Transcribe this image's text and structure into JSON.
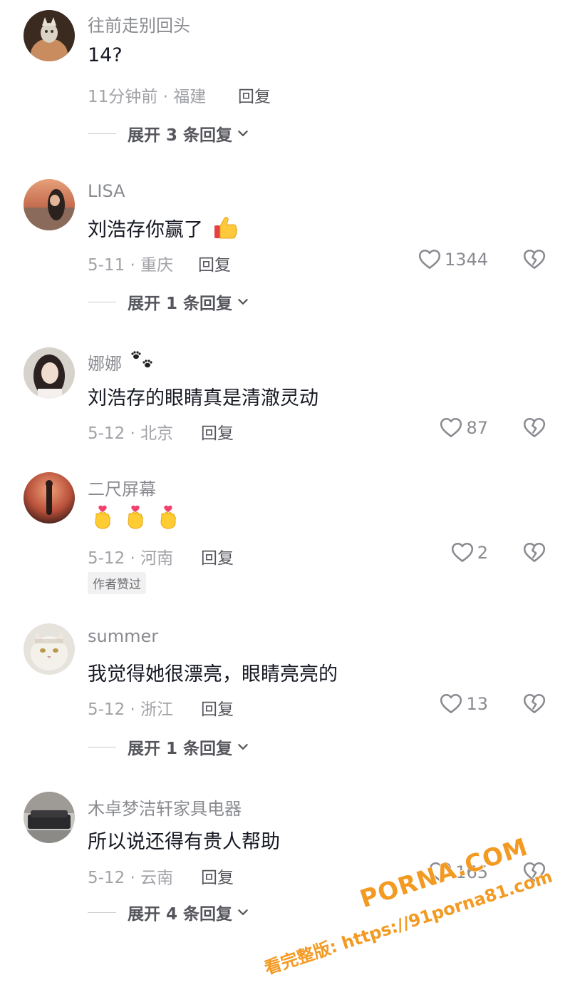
{
  "comments": [
    {
      "username": "往前走别回头",
      "text": "14?",
      "meta": "11分钟前 · 福建",
      "reply_label": "回复",
      "expand_label": "展开 3 条回复"
    },
    {
      "username": "LISA",
      "text": "刘浩存你赢了",
      "meta": "5-11 · 重庆",
      "reply_label": "回复",
      "likes": "1344",
      "expand_label": "展开 1 条回复"
    },
    {
      "username": "娜娜",
      "text": "刘浩存的眼睛真是清澈灵动",
      "meta": "5-12 · 北京",
      "reply_label": "回复",
      "likes": "87"
    },
    {
      "username": "二尺屏幕",
      "meta": "5-12 · 河南",
      "reply_label": "回复",
      "likes": "2",
      "badge": "作者赞过"
    },
    {
      "username": "summer",
      "text": "我觉得她很漂亮，眼睛亮亮的",
      "meta": "5-12 · 浙江",
      "reply_label": "回复",
      "likes": "13",
      "expand_label": "展开 1 条回复"
    },
    {
      "username": "木卓梦洁轩家具电器",
      "text": "所以说还得有贵人帮助",
      "meta": "5-12 · 云南",
      "reply_label": "回复",
      "likes": "165",
      "expand_label": "展开 4 条回复"
    }
  ],
  "watermark": {
    "line1": "PORNA.COM",
    "line2": "看完整版: https://91porna81.com"
  },
  "icons": {
    "like": "heart-outline-icon",
    "dislike": "broken-heart-icon",
    "expand": "chevron-down-icon",
    "thumbs_up_emoji": "thumbs-up-emoji",
    "finger_heart_emoji": "finger-heart-emoji",
    "paw_emoji": "paw-prints-emoji"
  },
  "colors": {
    "username": "#8a8b91",
    "text": "#161823",
    "meta": "#a1a2a7",
    "watermark": "#f39a22"
  }
}
